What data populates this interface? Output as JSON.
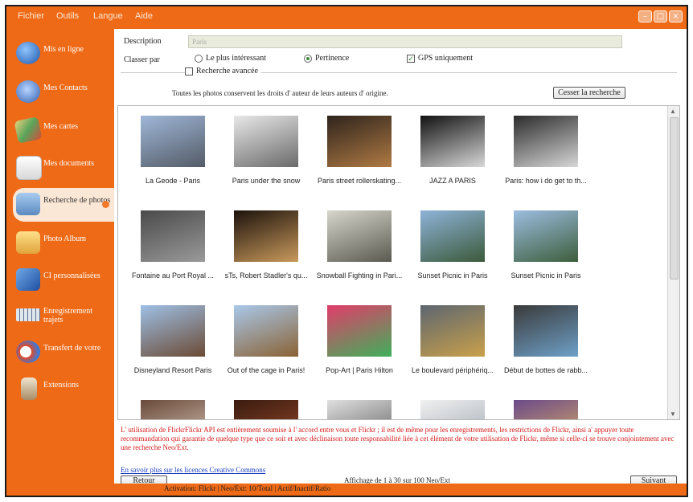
{
  "menu": [
    "Fichier",
    "Outils",
    "Langue",
    "Aide"
  ],
  "sidebar": [
    {
      "label": "Mis en ligne",
      "icon": "globe-icon",
      "color": "#2f6fd0"
    },
    {
      "label": "Mes Contacts",
      "icon": "contacts-icon",
      "color": "#3f7ad8"
    },
    {
      "label": "Mes cartes",
      "icon": "map-icon",
      "color": "#d9b24a"
    },
    {
      "label": "Mes documents",
      "icon": "documents-icon",
      "color": "#f2f2f2"
    },
    {
      "label": "Recherche de photos",
      "icon": "photo-search-icon",
      "color": "#6aa0d8"
    },
    {
      "label": "Photo Album",
      "icon": "folder-icon",
      "color": "#f3c24a"
    },
    {
      "label": "CI personnalisées",
      "icon": "custom-icon",
      "color": "#3a7ad8"
    },
    {
      "label": "Enregistrement trajets",
      "icon": "keyboard-icon",
      "color": "#5b6f8e"
    },
    {
      "label": "Transfert de votre",
      "icon": "transfer-icon",
      "color": "#e04a2a"
    },
    {
      "label": "Extensions",
      "icon": "extension-icon",
      "color": "#c9b190"
    }
  ],
  "search": {
    "description_label": "Description",
    "description_placeholder": "Paris",
    "sort_label": "Classer par",
    "sort_options": [
      "Le plus intéressant",
      "Pertinence"
    ],
    "gps_label": "GPS uniquement",
    "advanced_label": "Recherche avancée",
    "license_text": "Toutes les photos conservent les droits d' auteur de leurs auteurs d' origine.",
    "cancel_button": "Cesser la recherche"
  },
  "photos": [
    {
      "caption": "La Geode - Paris",
      "c1": "#9fb7d8",
      "c2": "#545b66"
    },
    {
      "caption": "Paris under the snow",
      "c1": "#e8e8e8",
      "c2": "#6a6a6a"
    },
    {
      "caption": "Paris street rollerskating...",
      "c1": "#2e241c",
      "c2": "#b07a44"
    },
    {
      "caption": "JAZZ A PARIS",
      "c1": "#111111",
      "c2": "#d8d8d8"
    },
    {
      "caption": "Paris: how i do get to th...",
      "c1": "#2b2b2b",
      "c2": "#d7d7d7"
    },
    {
      "caption": "Fontaine au Port Royal ...",
      "c1": "#4a4a4a",
      "c2": "#9a9a9a"
    },
    {
      "caption": "sTs, Robert Stadler's qu...",
      "c1": "#1c120c",
      "c2": "#c99a5c"
    },
    {
      "caption": "Snowball Fighting in Pari...",
      "c1": "#d6d6cc",
      "c2": "#5a5a50"
    },
    {
      "caption": "Sunset Picnic in Paris",
      "c1": "#8fb3d9",
      "c2": "#3b5a3a"
    },
    {
      "caption": "Sunset Picnic in Paris",
      "c1": "#9cbde0",
      "c2": "#3d5e3b"
    },
    {
      "caption": "Disneyland Resort Paris",
      "c1": "#9ec0e6",
      "c2": "#6b4a34"
    },
    {
      "caption": "Out of the cage in Paris!",
      "c1": "#a9c8ea",
      "c2": "#8a6234"
    },
    {
      "caption": "Pop-Art | Paris Hilton",
      "c1": "#e23c6a",
      "c2": "#3fb05a"
    },
    {
      "caption": "Le boulevard périphériq...",
      "c1": "#5d6670",
      "c2": "#c9a04a"
    },
    {
      "caption": "Début de bottes de rabb...",
      "c1": "#3a3a3a",
      "c2": "#6ea0c8"
    },
    {
      "caption": "",
      "c1": "#6a4a3a",
      "c2": "#d9c9b9"
    },
    {
      "caption": "",
      "c1": "#3a1c10",
      "c2": "#9a4a2a"
    },
    {
      "caption": "",
      "c1": "#e0e0e0",
      "c2": "#555555"
    },
    {
      "caption": "",
      "c1": "#f0f0f0",
      "c2": "#9aa4b0"
    },
    {
      "caption": "",
      "c1": "#6a4a8a",
      "c2": "#e0b060"
    }
  ],
  "notice": "L' utilisation de FlickrFlickr API est entièrement soumise à l' accord entre vous et Flickr ; il est de même pour les enregistrements, les restrictions de Flickr, ainsi a' appuyer toute recommandation qui garantie de quelque type que ce soit et avec déclinaison toute responsabilité liée à cet élément de votre utilisation de Flickr, même si celle-ci se trouve conjointement avec une recherche Neo/Ext.",
  "creative_commons_link": "En savoir plus sur les licences Creative Commons",
  "pagination": {
    "back": "Retour",
    "info": "Affichage de 1 à 30 sur 100 Neo/Ext",
    "next": "Suivant"
  },
  "statusbar": "Activation: Flickr | Neo/Ext: 10/Total | Actif/Inactif/Ratio"
}
